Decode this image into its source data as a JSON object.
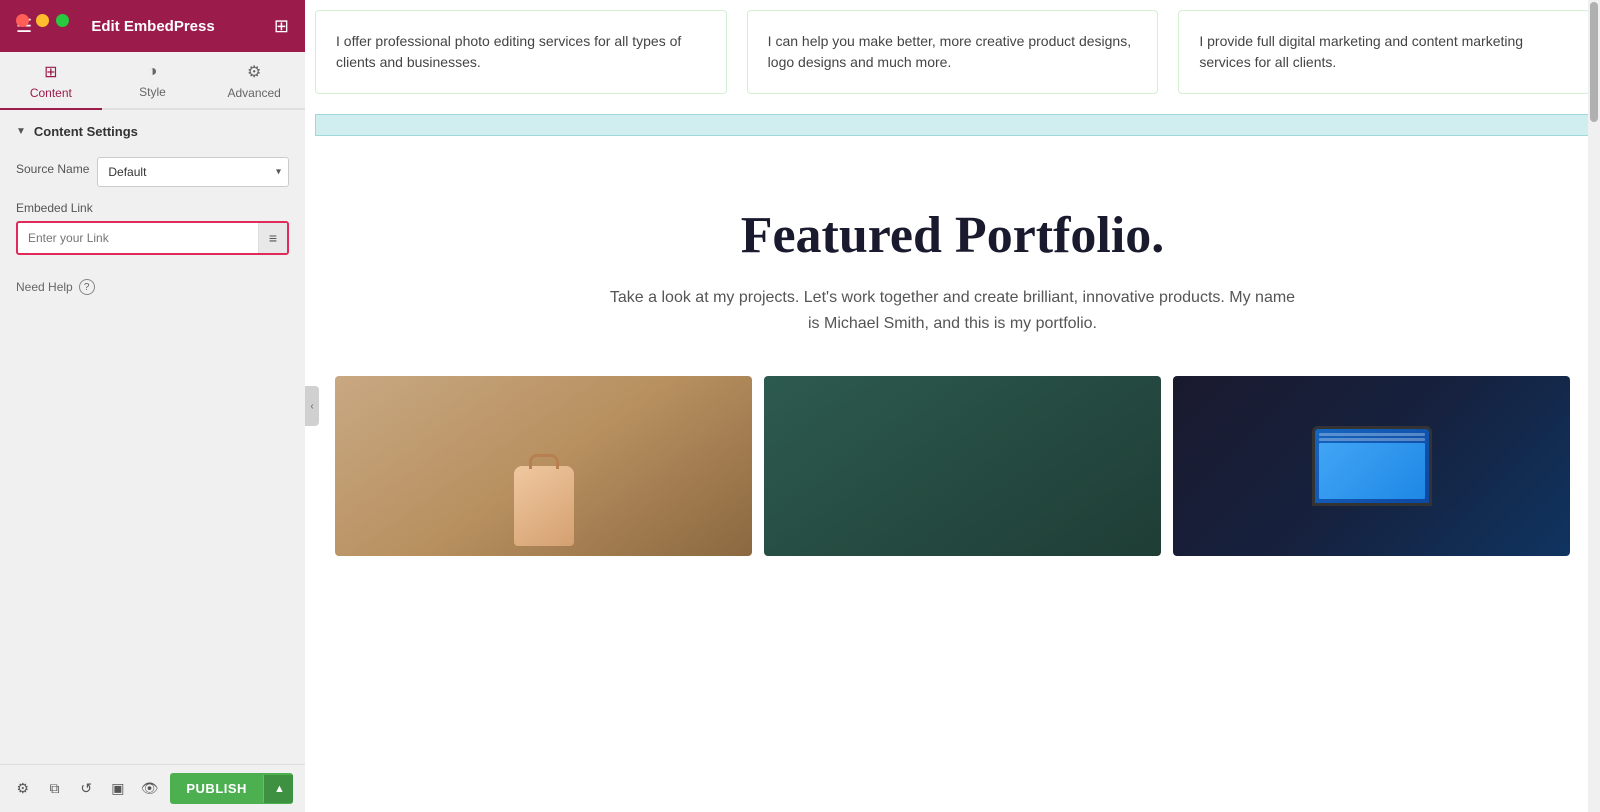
{
  "app": {
    "title": "Edit EmbedPress"
  },
  "macos": {
    "dots": [
      "red",
      "yellow",
      "green"
    ]
  },
  "tabs": [
    {
      "id": "content",
      "label": "Content",
      "icon": "⊞",
      "active": true
    },
    {
      "id": "style",
      "label": "Style",
      "icon": "◑",
      "active": false
    },
    {
      "id": "advanced",
      "label": "Advanced",
      "icon": "⚙",
      "active": false
    }
  ],
  "content_settings": {
    "section_label": "Content Settings",
    "source_name_label": "Source Name",
    "source_name_value": "Default",
    "source_name_options": [
      "Default"
    ],
    "embed_link_label": "Embeded Link",
    "embed_link_placeholder": "Enter your Link"
  },
  "need_help": {
    "label": "Need Help"
  },
  "toolbar": {
    "publish_label": "PUBLISH"
  },
  "preview": {
    "cards": [
      {
        "text": "I offer professional photo editing services for all types of clients and businesses."
      },
      {
        "text": "I can help you make better, more creative product designs, logo designs and much more."
      },
      {
        "text": "I provide full digital marketing and content marketing services for all clients."
      }
    ],
    "portfolio": {
      "title": "Featured Portfolio.",
      "description": "Take a look at my projects. Let's work together and create brilliant, innovative products. My name is Michael Smith, and this is my portfolio."
    }
  }
}
